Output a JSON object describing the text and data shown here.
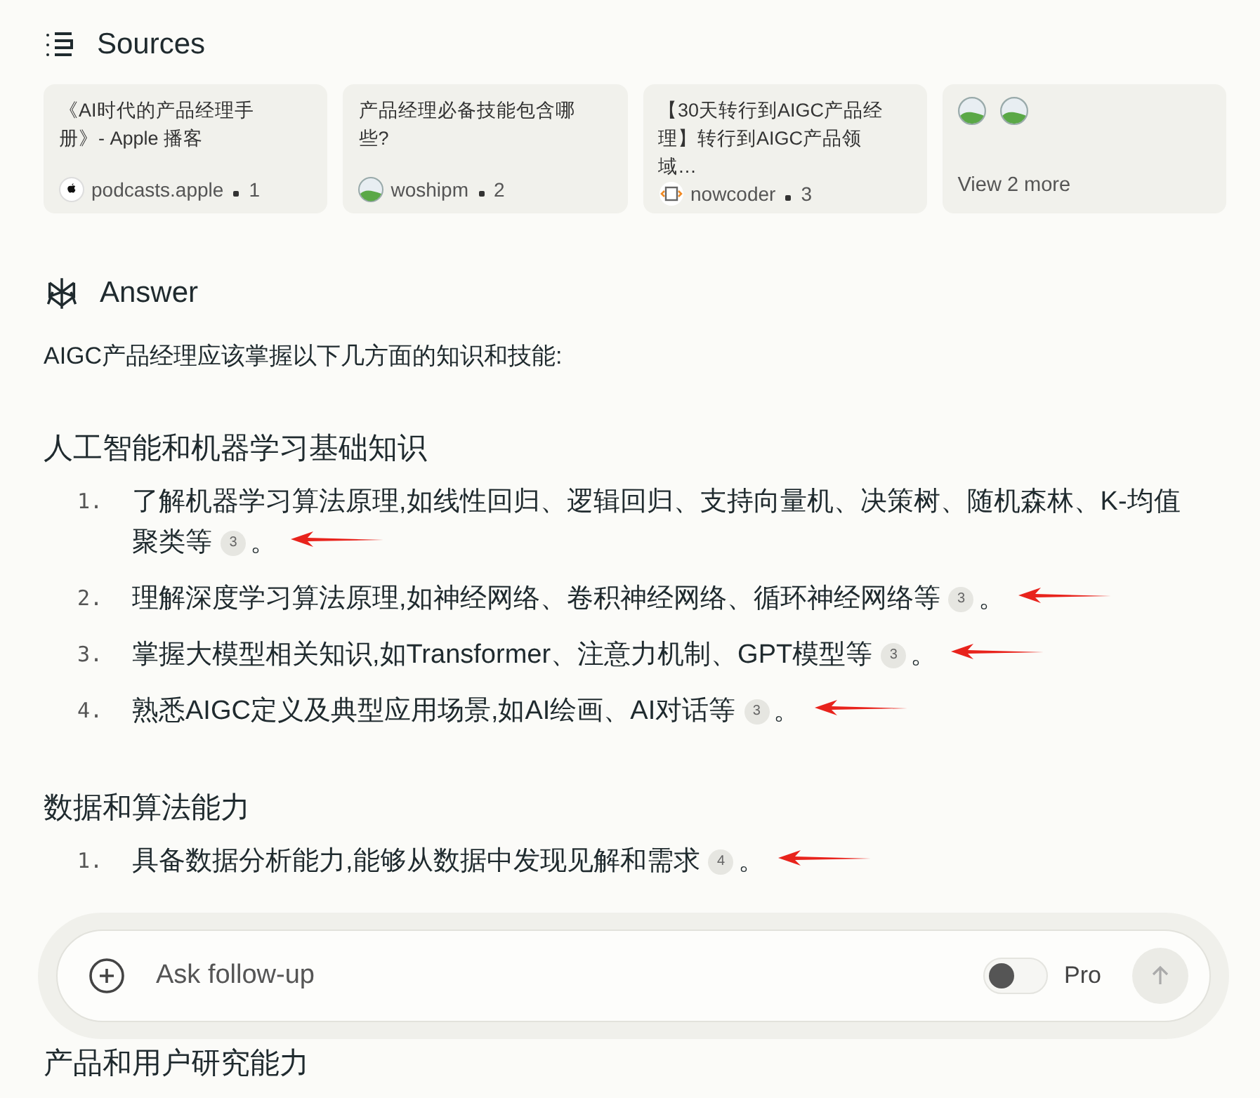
{
  "sources": {
    "title": "Sources",
    "cards": [
      {
        "kind": "source",
        "title": "《AI时代的产品经理手册》- Apple 播客",
        "favicon": {
          "kind": "apple"
        },
        "site": "podcasts.apple",
        "num": "1"
      },
      {
        "kind": "source",
        "title": "产品经理必备技能包含哪些?",
        "favicon": {
          "kind": "image"
        },
        "site": "woshipm",
        "num": "2"
      },
      {
        "kind": "source",
        "title": "【30天转行到AIGC产品经理】转行到AIGC产品领域…",
        "favicon": {
          "kind": "code"
        },
        "site": "nowcoder",
        "num": "3"
      },
      {
        "kind": "more",
        "icons": [
          {
            "kind": "image"
          },
          {
            "kind": "image"
          }
        ],
        "label": "View 2 more"
      }
    ]
  },
  "answer": {
    "title": "Answer",
    "intro": "AIGC产品经理应该掌握以下几方面的知识和技能:",
    "sections": [
      {
        "heading": "人工智能和机器学习基础知识",
        "items": [
          {
            "number": "1.",
            "text": "了解机器学习算法原理,如线性回归、逻辑回归、支持向量机、决策树、随机森林、K-均值聚类等",
            "citation": "3",
            "end": "。",
            "annotated": true
          },
          {
            "number": "2.",
            "text": "理解深度学习算法原理,如神经网络、卷积神经网络、循环神经网络等",
            "citation": "3",
            "end": "。",
            "annotated": true
          },
          {
            "number": "3.",
            "text": "掌握大模型相关知识,如Transformer、注意力机制、GPT模型等",
            "citation": "3",
            "end": "。",
            "annotated": true
          },
          {
            "number": "4.",
            "text": "熟悉AIGC定义及典型应用场景,如AI绘画、AI对话等",
            "citation": "3",
            "end": "。",
            "annotated": true
          }
        ]
      },
      {
        "heading": "数据和算法能力",
        "items": [
          {
            "number": "1.",
            "text": "具备数据分析能力,能够从数据中发现见解和需求",
            "citation": "4",
            "end": "。",
            "annotated": true
          }
        ]
      },
      {
        "heading": "产品和用户研究能力"
      }
    ]
  },
  "composer": {
    "placeholder": "Ask follow-up",
    "pro": {
      "label": "Pro",
      "on": false
    },
    "send": {
      "disabled": true
    }
  }
}
